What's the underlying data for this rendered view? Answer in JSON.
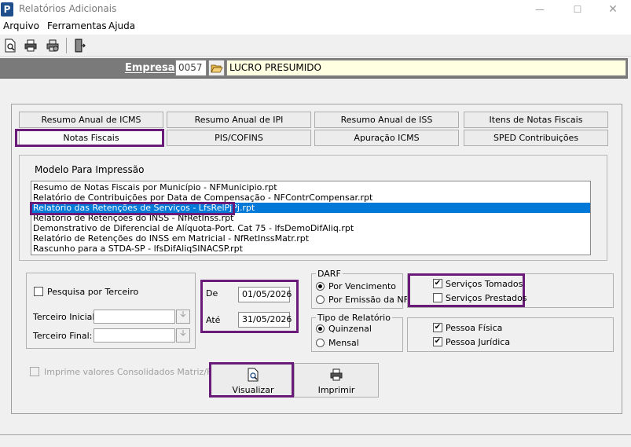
{
  "window": {
    "title": "Relatórios Adicionais",
    "app_icon_letter": "P",
    "min_glyph": "—",
    "max_glyph": "☐",
    "close_glyph": "✕"
  },
  "menu": [
    "Arquivo",
    "Ferramentas",
    "Ajuda"
  ],
  "toolbar": {
    "icons": [
      "preview-icon",
      "print-icon",
      "print-setup-icon",
      "exit-door-icon"
    ]
  },
  "empresa": {
    "label": "Empresa",
    "code": "0057",
    "name": "LUCRO PRESUMIDO"
  },
  "tabs": {
    "row1": [
      "Resumo Anual de ICMS",
      "Resumo Anual de IPI",
      "Resumo Anual de ISS",
      "Itens de Notas Fiscais"
    ],
    "row2": [
      "Notas Fiscais",
      "PIS/COFINS",
      "Apuração ICMS",
      "SPED Contribuições"
    ]
  },
  "modelo": {
    "title": "Modelo Para Impressão",
    "items": [
      "Resumo de Notas Fiscais por Município - NFMunicipio.rpt",
      "Relatório de Contribuições por Data de Compensação - NFContrCompensar.rpt",
      "Relatório das Retenções de Serviços - LfsRelPjPj.rpt",
      "Relatório de Retenções do INSS - NfRetInss.rpt",
      "Demonstrativo de Diferencial de Alíquota-Port. Cat 75 - lfsDemoDifAliq.rpt",
      "Relatório de Retenções do INSS em Matricial - NfRetInssMatr.rpt",
      "Rascunho para a STDA-SP - lfsDifAliqSINACSP.rpt"
    ],
    "selected_index": 2
  },
  "terceiro": {
    "pesquisa_label": "Pesquisa por Terceiro",
    "pesquisa_checked": false,
    "inicial_label": "Terceiro Inicial:",
    "final_label": "Terceiro Final:",
    "consolidados_label": "Imprime valores Consolidados Matriz/Filial"
  },
  "periodo": {
    "de_label": "De",
    "de_value": "01/05/2026",
    "ate_label": "Até",
    "ate_value": "31/05/2026"
  },
  "darf": {
    "title": "DARF",
    "options": [
      "Por Vencimento",
      "Por Emissão da NF"
    ],
    "selected": 0
  },
  "tipo_relatorio": {
    "title": "Tipo de Relatório",
    "options": [
      "Quinzenal",
      "Mensal"
    ],
    "selected": 0
  },
  "servicos": {
    "tomados_label": "Serviços Tomados",
    "tomados_checked": true,
    "prestados_label": "Serviços Prestados",
    "prestados_checked": false
  },
  "pessoa": {
    "fisica_label": "Pessoa Física",
    "fisica_checked": true,
    "juridica_label": "Pessoa Jurídica",
    "juridica_checked": true
  },
  "buttons": {
    "visualizar": "Visualizar",
    "imprimir": "Imprimir"
  },
  "colors": {
    "highlight": "#6a1b7a",
    "selection": "#0078d7",
    "empresa_bar": "#7a7a7a",
    "empresa_name_bg": "#ffffe1"
  }
}
